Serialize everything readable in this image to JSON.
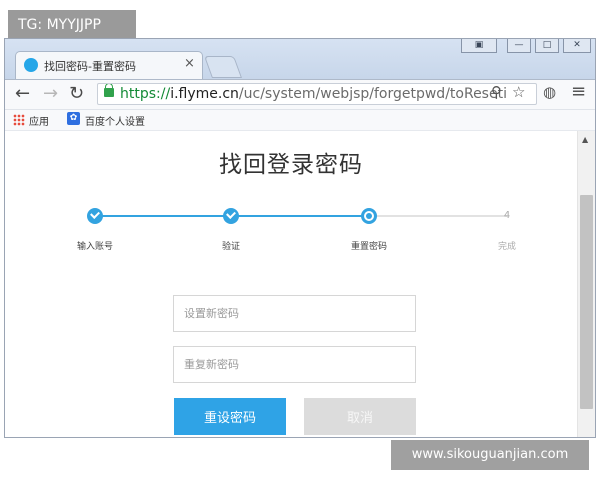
{
  "watermarks": {
    "top": "TG: MYYJJPP",
    "bottom": "www.sikouguanjian.com"
  },
  "browser": {
    "tab": {
      "title": "找回密码-重置密码",
      "close": "×"
    },
    "window_controls": {
      "user": "▣",
      "minimize": "—",
      "maximize": "□",
      "close": "✕"
    },
    "nav": {
      "back": "←",
      "forward": "→",
      "reload": "↻"
    },
    "url": {
      "scheme": "https://",
      "host": "i.flyme.cn",
      "path": "/uc/system/webjsp/forgetpwd/toReseti"
    },
    "url_icons": {
      "search": "⚲",
      "star": "☆",
      "extension": "◍",
      "menu": "≡"
    },
    "bookmarks": [
      {
        "label": "应用"
      },
      {
        "label": "百度个人设置"
      }
    ],
    "paw_glyph": "✿"
  },
  "page": {
    "title": "找回登录密码",
    "steps": [
      {
        "label": "输入账号",
        "state": "done"
      },
      {
        "label": "验证",
        "state": "done"
      },
      {
        "label": "重置密码",
        "state": "current"
      },
      {
        "label": "完成",
        "state": "todo",
        "number": "4"
      }
    ],
    "fields": {
      "new_password": {
        "placeholder": "设置新密码",
        "value": ""
      },
      "confirm_password": {
        "placeholder": "重复新密码",
        "value": ""
      }
    },
    "buttons": {
      "reset": "重设密码",
      "cancel": "取消"
    }
  },
  "colors": {
    "accent": "#2fa3e6",
    "step_done": "#33a3e0",
    "step_todo": "#e2e2e2",
    "button_disabled": "#dcdcdc"
  }
}
